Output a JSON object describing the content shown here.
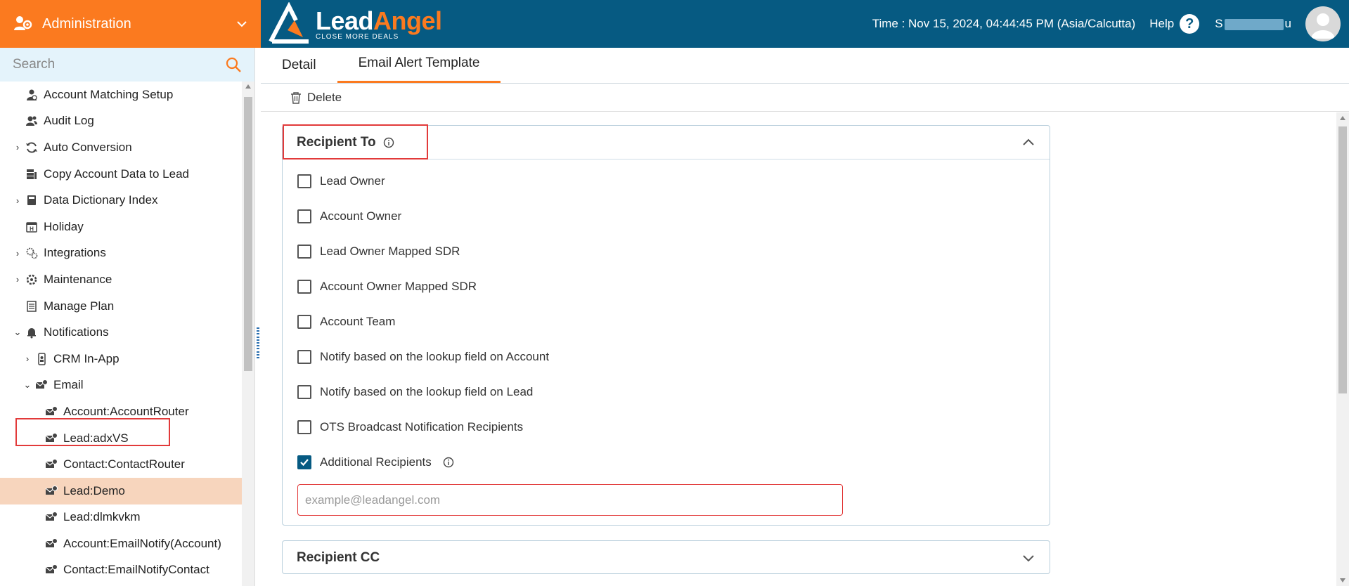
{
  "admin": {
    "label": "Administration"
  },
  "brand": {
    "lead": "Lead",
    "angel": "Angel",
    "tagline": "CLOSE MORE DEALS"
  },
  "header": {
    "time": "Time : Nov 15, 2024, 04:44:45 PM (Asia/Calcutta)",
    "help": "Help",
    "user_prefix": "S",
    "user_suffix": "u"
  },
  "search": {
    "placeholder": "Search"
  },
  "tree": [
    {
      "label": "Account Matching Setup"
    },
    {
      "label": "Audit Log"
    },
    {
      "label": "Auto Conversion"
    },
    {
      "label": "Copy Account Data to Lead"
    },
    {
      "label": "Data Dictionary Index"
    },
    {
      "label": "Holiday"
    },
    {
      "label": "Integrations"
    },
    {
      "label": "Maintenance"
    },
    {
      "label": "Manage Plan"
    },
    {
      "label": "Notifications"
    },
    {
      "label": "CRM In-App"
    },
    {
      "label": "Email"
    },
    {
      "label": "Account:AccountRouter"
    },
    {
      "label": "Lead:adxVS"
    },
    {
      "label": "Contact:ContactRouter"
    },
    {
      "label": "Lead:Demo"
    },
    {
      "label": "Lead:dlmkvkm"
    },
    {
      "label": "Account:EmailNotify(Account)"
    },
    {
      "label": "Contact:EmailNotifyContact"
    }
  ],
  "tabs": {
    "detail": "Detail",
    "email_alert": "Email Alert Template"
  },
  "toolbar": {
    "delete": "Delete"
  },
  "recipient_to": {
    "title": "Recipient To",
    "options": [
      {
        "label": "Lead Owner",
        "checked": false
      },
      {
        "label": "Account Owner",
        "checked": false
      },
      {
        "label": "Lead Owner Mapped SDR",
        "checked": false
      },
      {
        "label": "Account Owner Mapped SDR",
        "checked": false
      },
      {
        "label": "Account Team",
        "checked": false
      },
      {
        "label": "Notify based on the lookup field on Account",
        "checked": false
      },
      {
        "label": "Notify based on the lookup field on Lead",
        "checked": false
      },
      {
        "label": "OTS Broadcast Notification Recipients",
        "checked": false
      },
      {
        "label": "Additional Recipients",
        "checked": true
      }
    ],
    "email_placeholder": "example@leadangel.com"
  },
  "recipient_cc": {
    "title": "Recipient CC"
  },
  "colors": {
    "orange": "#fb7a1f",
    "navy": "#065a82",
    "highlight": "#e23a3a",
    "selected_row": "#f7d5bd"
  }
}
